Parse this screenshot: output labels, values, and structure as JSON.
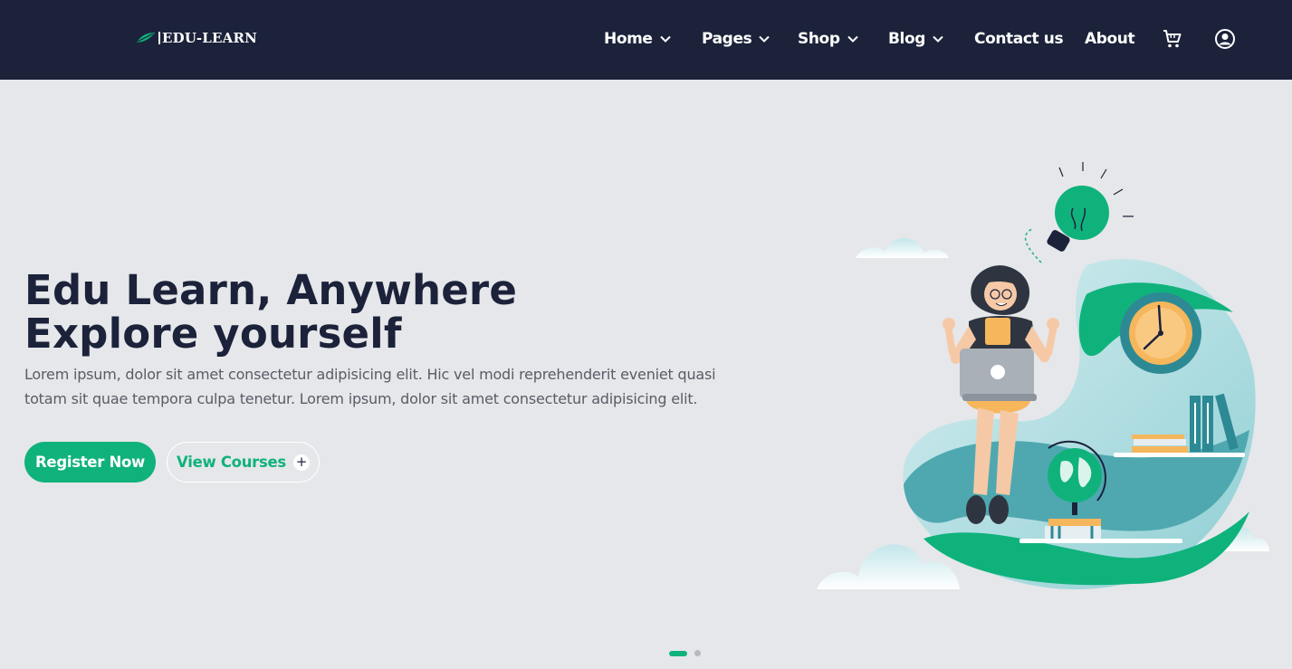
{
  "brand": {
    "name": "EDU-LEARN",
    "accent": "#10b27c",
    "navbar_bg": "#1b223a"
  },
  "nav": {
    "items": [
      {
        "label": "Home",
        "dropdown": true
      },
      {
        "label": "Pages",
        "dropdown": true
      },
      {
        "label": "Shop",
        "dropdown": true
      },
      {
        "label": "Blog",
        "dropdown": true
      },
      {
        "label": "Contact us",
        "dropdown": false
      },
      {
        "label": "About",
        "dropdown": false
      }
    ],
    "icons": [
      "shopping-cart-icon",
      "account-circle-icon"
    ]
  },
  "hero": {
    "title_line1": "Edu Learn, Anywhere",
    "title_line2": "Explore yourself",
    "description": "Lorem ipsum, dolor sit amet consectetur adipisicing elit. Hic vel modi reprehenderit eveniet quasi totam sit quae tempora culpa tenetur. Lorem ipsum, dolor sit amet consectetur adipisicing elit.",
    "primary_button": "Register Now",
    "secondary_button": "View Courses"
  },
  "carousel": {
    "slides": 2,
    "active_index": 0
  }
}
